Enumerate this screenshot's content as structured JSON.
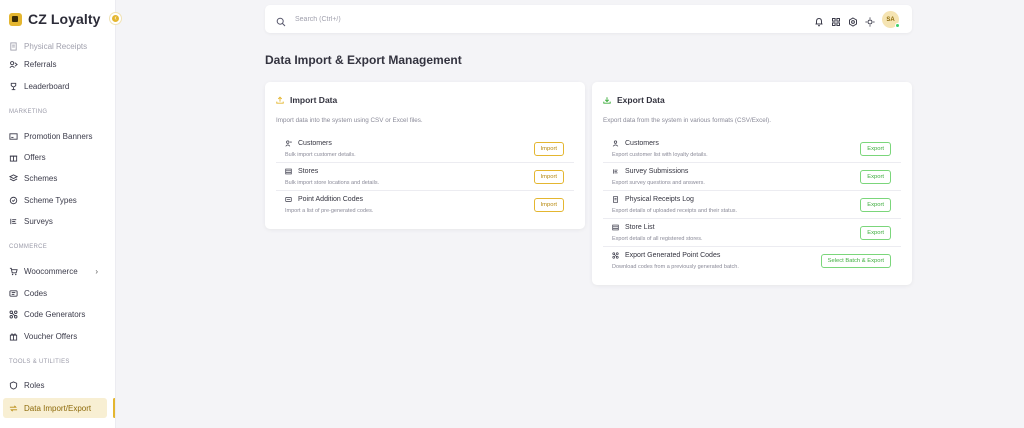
{
  "brand": {
    "name": "CZ Loyalty"
  },
  "sidebar": {
    "items": [
      {
        "label": "Physical Receipts",
        "icon": "receipt-icon"
      },
      {
        "label": "Referrals",
        "icon": "referrals-icon"
      },
      {
        "label": "Leaderboard",
        "icon": "trophy-icon"
      },
      {
        "label": "Promotion Banners",
        "icon": "banner-icon"
      },
      {
        "label": "Offers",
        "icon": "gift-icon"
      },
      {
        "label": "Schemes",
        "icon": "schemes-icon"
      },
      {
        "label": "Scheme Types",
        "icon": "scheme-types-icon"
      },
      {
        "label": "Surveys",
        "icon": "surveys-icon"
      },
      {
        "label": "Woocommerce",
        "icon": "cart-icon"
      },
      {
        "label": "Codes",
        "icon": "codes-icon"
      },
      {
        "label": "Code Generators",
        "icon": "code-generator-icon"
      },
      {
        "label": "Voucher Offers",
        "icon": "voucher-icon"
      },
      {
        "label": "Roles",
        "icon": "shield-icon"
      },
      {
        "label": "Data Import/Export",
        "icon": "import-export-icon"
      }
    ],
    "sections": {
      "marketing": "MARKETING",
      "commerce": "COMMERCE",
      "tools": "TOOLS & UTILITIES"
    }
  },
  "header": {
    "search_placeholder": "Search (Ctrl+/)",
    "avatar_initials": "SA"
  },
  "page": {
    "title": "Data Import & Export Management"
  },
  "import": {
    "title": "Import Data",
    "description": "Import data into the system using CSV or Excel files.",
    "rows": [
      {
        "title": "Customers",
        "sub": "Bulk import customer details.",
        "button": "Import",
        "icon": "user-plus-icon"
      },
      {
        "title": "Stores",
        "sub": "Bulk import store locations and details.",
        "button": "Import",
        "icon": "store-icon"
      },
      {
        "title": "Point Addition Codes",
        "sub": "Import a list of pre-generated codes.",
        "button": "Import",
        "icon": "barcode-icon"
      }
    ]
  },
  "export": {
    "title": "Export Data",
    "description": "Export data from the system in various formats (CSV/Excel).",
    "rows": [
      {
        "title": "Customers",
        "sub": "Export customer list with loyalty details.",
        "button": "Export",
        "icon": "user-icon"
      },
      {
        "title": "Survey Submissions",
        "sub": "Export survey questions and answers.",
        "button": "Export",
        "icon": "survey-icon"
      },
      {
        "title": "Physical Receipts Log",
        "sub": "Export details of uploaded receipts and their status.",
        "button": "Export",
        "icon": "receipt-icon"
      },
      {
        "title": "Store List",
        "sub": "Export details of all registered stores.",
        "button": "Export",
        "icon": "store-icon"
      },
      {
        "title": "Export Generated Point Codes",
        "sub": "Download codes from a previously generated batch.",
        "button": "Select Batch & Export",
        "icon": "code-generator-icon"
      }
    ]
  },
  "colors": {
    "accent": "#e4b630",
    "export_green": "#3fae3f",
    "active_bg": "#f8efd3"
  }
}
